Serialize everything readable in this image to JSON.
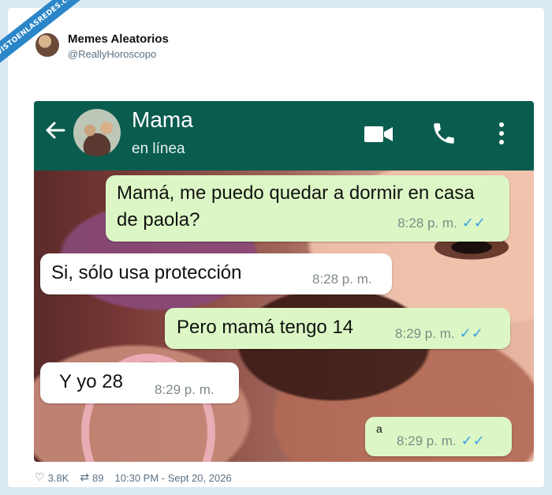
{
  "watermark": {
    "text": "VISTOENLASREDES.com"
  },
  "tweet": {
    "author_name": "Memes Aleatorios",
    "author_handle": "@ReallyHoroscopo",
    "likes": "3.8K",
    "retweets": "89",
    "timestamp": "10:30 PM - Sept 20, 2026"
  },
  "chat": {
    "contact_name": "Mama",
    "contact_status": "en línea",
    "messages": [
      {
        "direction": "out",
        "text": "Mamá, me puedo quedar a dormir en casa de paola?",
        "time": "8:28 p. m."
      },
      {
        "direction": "in",
        "text": "Si, sólo usa protección",
        "time": "8:28 p. m."
      },
      {
        "direction": "out",
        "text": "Pero mamá tengo 14",
        "time": "8:29 p. m."
      },
      {
        "direction": "in",
        "text": "Y yo 28",
        "time": "8:29 p. m."
      },
      {
        "direction": "out",
        "text": "a",
        "time": "8:29 p. m."
      }
    ]
  },
  "icons": {
    "back": "arrow-left-icon",
    "video": "video-camera-icon",
    "call": "phone-icon",
    "menu": "vertical-dots-icon",
    "read": "double-check-icon",
    "like": "heart-icon",
    "retweet": "retweet-icon"
  },
  "colors": {
    "header": "#0a5c4f",
    "outgoing_bubble": "#dcf7c5",
    "incoming_bubble": "#ffffff",
    "read_ticks": "#3aa0e3",
    "watermark": "#2a86c8"
  }
}
